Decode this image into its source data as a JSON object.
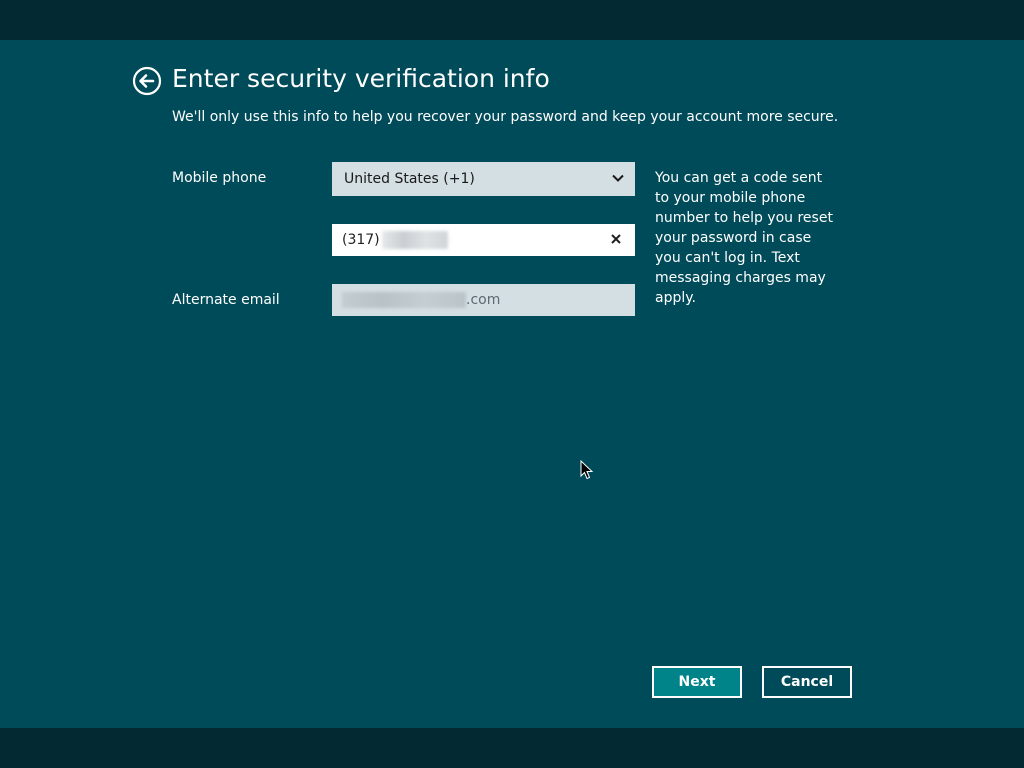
{
  "header": {
    "title": "Enter security verification info",
    "subtitle": "We'll only use this info to help you recover your password and keep your account more secure.",
    "back_icon": "back-arrow-circle-icon"
  },
  "form": {
    "mobile_phone_label": "Mobile phone",
    "country_value": "United States (+1)",
    "phone_value_visible": "(317)",
    "alternate_email_label": "Alternate email",
    "email_value_visible": ".com"
  },
  "help_text": "You can get a code sent to your mobile phone number to help you reset your password in case you can't log in. Text messaging charges may apply.",
  "buttons": {
    "next": "Next",
    "cancel": "Cancel"
  },
  "colors": {
    "background": "#004b5a",
    "bands": "#032a33",
    "field_bg": "#d4dfe3",
    "next_button": "#00848a"
  }
}
